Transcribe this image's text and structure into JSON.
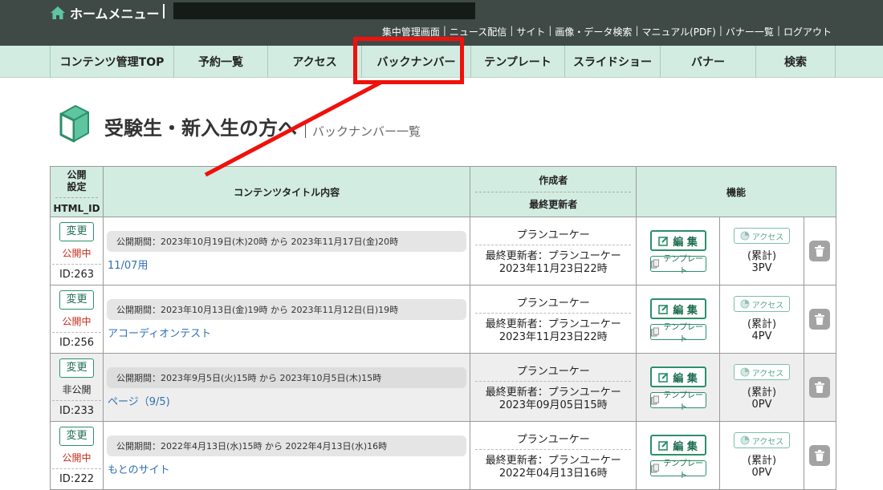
{
  "header": {
    "home_label": "ホームメニュー",
    "links": [
      "集中管理画面",
      "ニュース配信",
      "サイト",
      "画像・データ検索",
      "マニュアル(PDF)",
      "バナー一覧",
      "ログアウト"
    ]
  },
  "nav": {
    "items": [
      "コンテンツ管理TOP",
      "予約一覧",
      "アクセス",
      "バックナンバー",
      "テンプレート",
      "スライドショー",
      "バナー",
      "検索"
    ]
  },
  "page": {
    "title": "受験生・新入生の方へ",
    "subtitle": "バックナンバー一覧"
  },
  "table": {
    "headers": {
      "status_1": "公開",
      "status_2": "設定",
      "status_3": "HTML_ID",
      "title": "コンテンツタイトル内容",
      "author_1": "作成者",
      "author_2": "最終更新者",
      "function": "機能"
    },
    "buttons": {
      "change": "変更",
      "edit": "編 集",
      "template": "テンプレート",
      "access": "アクセス",
      "cumulative": "(累計)"
    },
    "rows": [
      {
        "status": "公開中",
        "id": "ID:263",
        "period": "公開期間：2023年10月19日(木)20時 から 2023年11月17日(金)20時",
        "title": "11/07用",
        "author": "プランユーケー",
        "updated_by": "最終更新者：プランユーケー",
        "updated_at": "2023年11月23日22時",
        "pv": "3PV"
      },
      {
        "status": "公開中",
        "id": "ID:256",
        "period": "公開期間：2023年10月13日(金)19時 から 2023年11月12日(日)19時",
        "title": "アコーディオンテスト",
        "author": "プランユーケー",
        "updated_by": "最終更新者：プランユーケー",
        "updated_at": "2023年11月23日22時",
        "pv": "4PV"
      },
      {
        "status": "非公開",
        "id": "ID:233",
        "period": "公開期間：2023年9月5日(火)15時 から 2023年10月5日(木)15時",
        "title": "ページ（9/5)",
        "author": "プランユーケー",
        "updated_by": "最終更新者：プランユーケー",
        "updated_at": "2023年09月05日15時",
        "pv": "0PV"
      },
      {
        "status": "公開中",
        "id": "ID:222",
        "period": "公開期間：2022年4月13日(水)15時 から 2022年4月13日(水)16時",
        "title": "もとのサイト",
        "author": "プランユーケー",
        "updated_by": "最終更新者：プランユーケー",
        "updated_at": "2022年04月13日16時",
        "pv": "0PV"
      }
    ]
  },
  "colors": {
    "header_bg": "#3f4a47",
    "nav_bg": "#d2ece2",
    "accent_green": "#2c8f6a",
    "highlight_red": "#f0100c",
    "status_public": "#c62a1a",
    "link_blue": "#2f6fb5"
  },
  "icons": [
    "home-icon",
    "book-icon",
    "edit-icon",
    "template-icon",
    "access-icon",
    "trash-icon"
  ]
}
